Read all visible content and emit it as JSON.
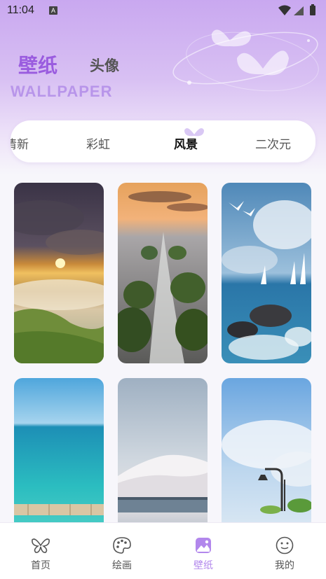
{
  "status_bar": {
    "time": "11:04",
    "notification_letter": "A"
  },
  "header": {
    "tabs": [
      {
        "label": "壁纸"
      },
      {
        "label": "头像"
      }
    ],
    "subtitle": "WALLPAPER"
  },
  "categories": [
    {
      "label": "清新"
    },
    {
      "label": "彩虹"
    },
    {
      "label": "风景"
    },
    {
      "label": "二次元"
    }
  ],
  "active_category": "风景",
  "wallpapers": [
    {
      "scene": "sunrise-above-clouds"
    },
    {
      "scene": "rocky-shore-sunset"
    },
    {
      "scene": "seagulls-sailboats-waves"
    },
    {
      "scene": "turquoise-sea-pier"
    },
    {
      "scene": "snowy-mountain-lake"
    },
    {
      "scene": "sky-street-lamp"
    }
  ],
  "bottom_nav": [
    {
      "label": "首页",
      "icon": "butterfly-icon"
    },
    {
      "label": "绘画",
      "icon": "palette-icon"
    },
    {
      "label": "壁纸",
      "icon": "wallpaper-icon"
    },
    {
      "label": "我的",
      "icon": "smiley-icon"
    }
  ],
  "active_nav": "壁纸",
  "colors": {
    "accent": "#b287ec",
    "title_purple": "#9a5cdf"
  }
}
